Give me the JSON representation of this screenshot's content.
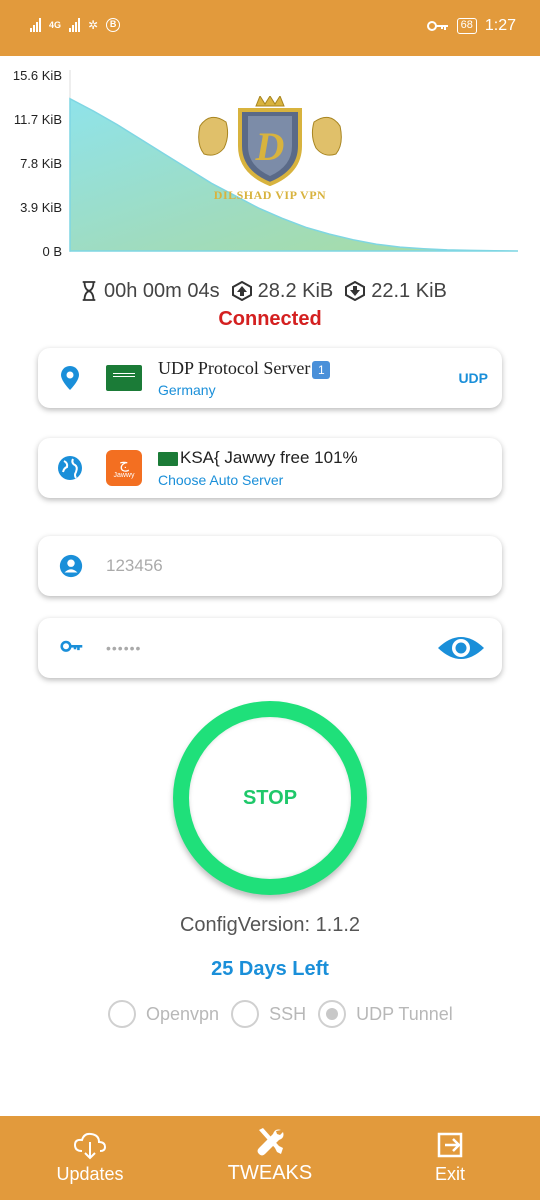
{
  "status_bar": {
    "network_label": "4G",
    "battery": "68",
    "time": "1:27"
  },
  "chart_data": {
    "type": "area",
    "y_tick_labels": [
      "15.6 KiB",
      "11.7 KiB",
      "7.8 KiB",
      "3.9 KiB",
      "0 B"
    ],
    "y_ticks": [
      15.6,
      11.7,
      7.8,
      3.9,
      0
    ],
    "ylim": [
      0,
      15.6
    ],
    "unit": "KiB",
    "series": [
      {
        "values": [
          13.5,
          12.4,
          11.2,
          9.9,
          8.6,
          7.3,
          6.0,
          4.9,
          3.8,
          2.9,
          2.1,
          1.5,
          1.0,
          0.6,
          0.35,
          0.2,
          0.1,
          0.05,
          0.02,
          0.0
        ]
      }
    ]
  },
  "logo": {
    "initial": "D",
    "text": "DILSHAD VIP VPN"
  },
  "stats": {
    "duration": "00h 00m 04s",
    "upload": "28.2 KiB",
    "download": "22.1 KiB"
  },
  "connection_status": "Connected",
  "server_card": {
    "title": "UDP Protocol Server",
    "emoji_digit": "1",
    "subtitle": "Germany",
    "protocol": "UDP"
  },
  "network_card": {
    "title": "KSA{ Jawwy free 101%",
    "subtitle": "Choose Auto Server",
    "logo_text": "Jawwy"
  },
  "username": {
    "value": "123456"
  },
  "password": {
    "value": "••••••"
  },
  "stop_button": {
    "label": "STOP"
  },
  "config_version": "ConfigVersion:  1.1.2",
  "days_left": "25 Days Left",
  "modes": [
    {
      "label": "Openvpn",
      "checked": false
    },
    {
      "label": "SSH",
      "checked": false
    },
    {
      "label": "UDP Tunnel",
      "checked": true
    }
  ],
  "bottom_nav": {
    "updates": "Updates",
    "tweaks": "TWEAKS",
    "exit": "Exit"
  },
  "colors": {
    "accent": "#e29a3c",
    "connected": "#d42020",
    "stop_ring": "#1fe07a",
    "link_blue": "#1a8fd9"
  }
}
